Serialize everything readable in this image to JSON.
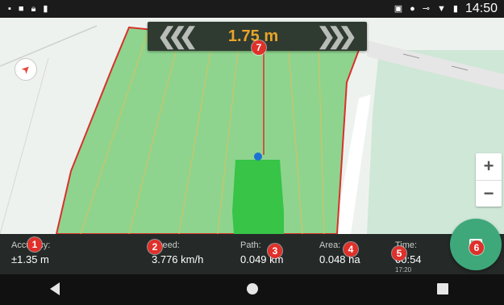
{
  "status_bar": {
    "time": "14:50",
    "left_icons": [
      "notification-icon",
      "message-icon",
      "lock-icon",
      "sd-card-icon"
    ],
    "right_icons": [
      "cast-icon",
      "location-icon",
      "key-icon",
      "wifi-icon",
      "battery-icon"
    ]
  },
  "guidance": {
    "cross_track": "1.75 m",
    "left_chevrons": "❮❮❮",
    "right_chevrons": "❯❯❯"
  },
  "map_controls": {
    "compass_glyph": "➤",
    "zoom_in": "+",
    "zoom_out": "−"
  },
  "info_bar": {
    "accuracy": {
      "label": "Accuracy:",
      "value": "±1.35 m"
    },
    "speed": {
      "label": "Speed:",
      "value": "3.776 km/h"
    },
    "path": {
      "label": "Path:",
      "value": "0.049 km"
    },
    "area": {
      "label": "Area:",
      "value": "0.048 ha"
    },
    "time": {
      "label": "Time:",
      "value": "00:54",
      "sub": "17:20"
    }
  },
  "markers": [
    "1",
    "2",
    "3",
    "4",
    "5",
    "6",
    "7"
  ],
  "colors": {
    "field_fill": "#8ed48f",
    "coverage": "#37c447",
    "boundary": "#d8312a",
    "accent": "#e8a52a",
    "fab": "#3ea87a"
  }
}
